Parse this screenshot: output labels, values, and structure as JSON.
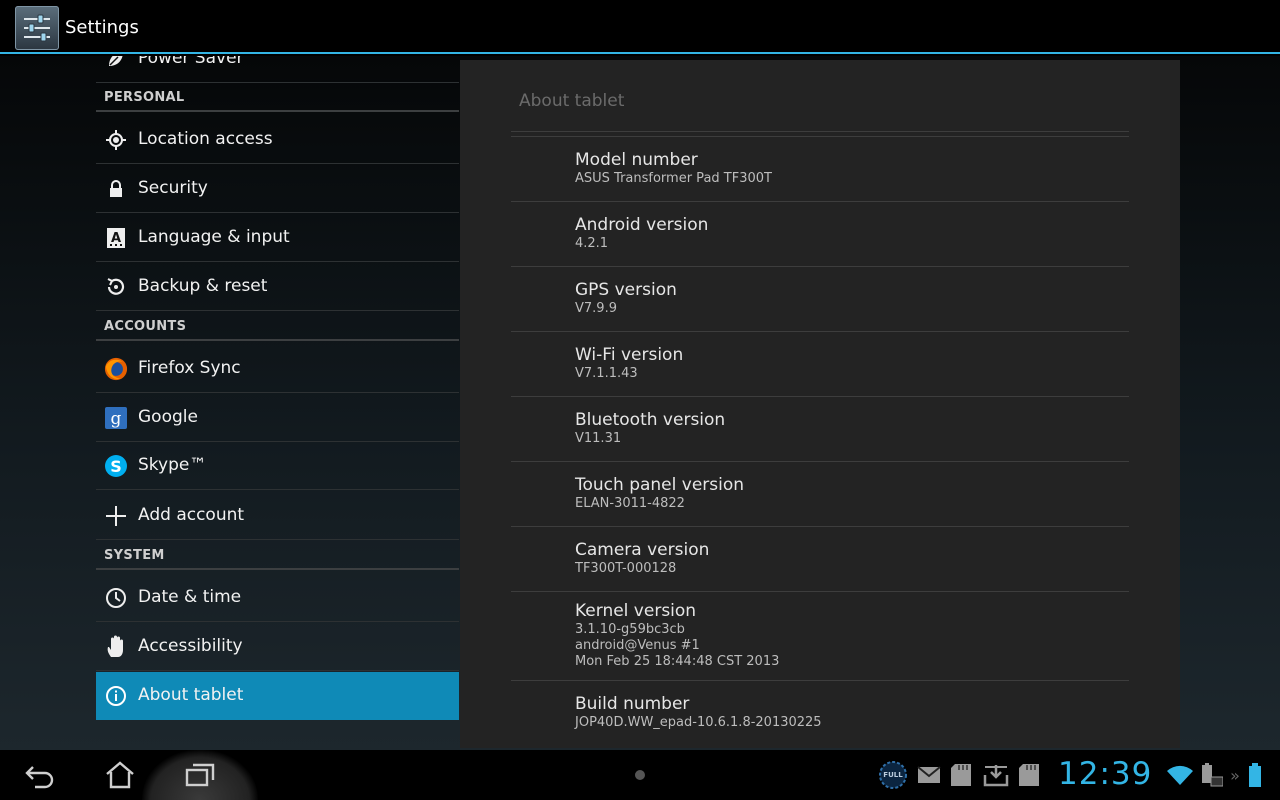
{
  "app": {
    "title": "Settings"
  },
  "sidebar": {
    "partial_item": "Power Saver",
    "sections": [
      {
        "header": "PERSONAL",
        "items": [
          {
            "label": "Location access",
            "icon": "location-icon"
          },
          {
            "label": "Security",
            "icon": "lock-icon"
          },
          {
            "label": "Language & input",
            "icon": "keyboard-icon"
          },
          {
            "label": "Backup & reset",
            "icon": "restore-icon"
          }
        ]
      },
      {
        "header": "ACCOUNTS",
        "items": [
          {
            "label": "Firefox Sync",
            "icon": "firefox-icon"
          },
          {
            "label": "Google",
            "icon": "google-icon"
          },
          {
            "label": "Skype™",
            "icon": "skype-icon"
          },
          {
            "label": "Add account",
            "icon": "plus-icon"
          }
        ]
      },
      {
        "header": "SYSTEM",
        "items": [
          {
            "label": "Date & time",
            "icon": "clock-icon"
          },
          {
            "label": "Accessibility",
            "icon": "hand-icon"
          },
          {
            "label": "About tablet",
            "icon": "info-icon",
            "selected": true
          }
        ]
      }
    ]
  },
  "detail": {
    "title": "About tablet",
    "items": [
      {
        "title": "Model number",
        "lines": [
          "ASUS Transformer Pad TF300T"
        ]
      },
      {
        "title": "Android version",
        "lines": [
          "4.2.1"
        ]
      },
      {
        "title": "GPS version",
        "lines": [
          "V7.9.9"
        ]
      },
      {
        "title": "Wi-Fi version",
        "lines": [
          "V7.1.1.43"
        ]
      },
      {
        "title": "Bluetooth version",
        "lines": [
          "V11.31"
        ]
      },
      {
        "title": "Touch panel version",
        "lines": [
          "ELAN-3011-4822"
        ]
      },
      {
        "title": "Camera version",
        "lines": [
          "TF300T-000128"
        ]
      },
      {
        "title": "Kernel version",
        "lines": [
          "3.1.10-g59bc3cb",
          "android@Venus #1",
          "Mon Feb 25 18:44:48 CST 2013"
        ]
      },
      {
        "title": "Build number",
        "lines": [
          "JOP40D.WW_epad-10.6.1.8-20130225"
        ]
      }
    ]
  },
  "status": {
    "clock": "12:39",
    "badge_text": "FULL",
    "accent_color": "#33b5e5",
    "selected_color": "#0f8ab7"
  }
}
